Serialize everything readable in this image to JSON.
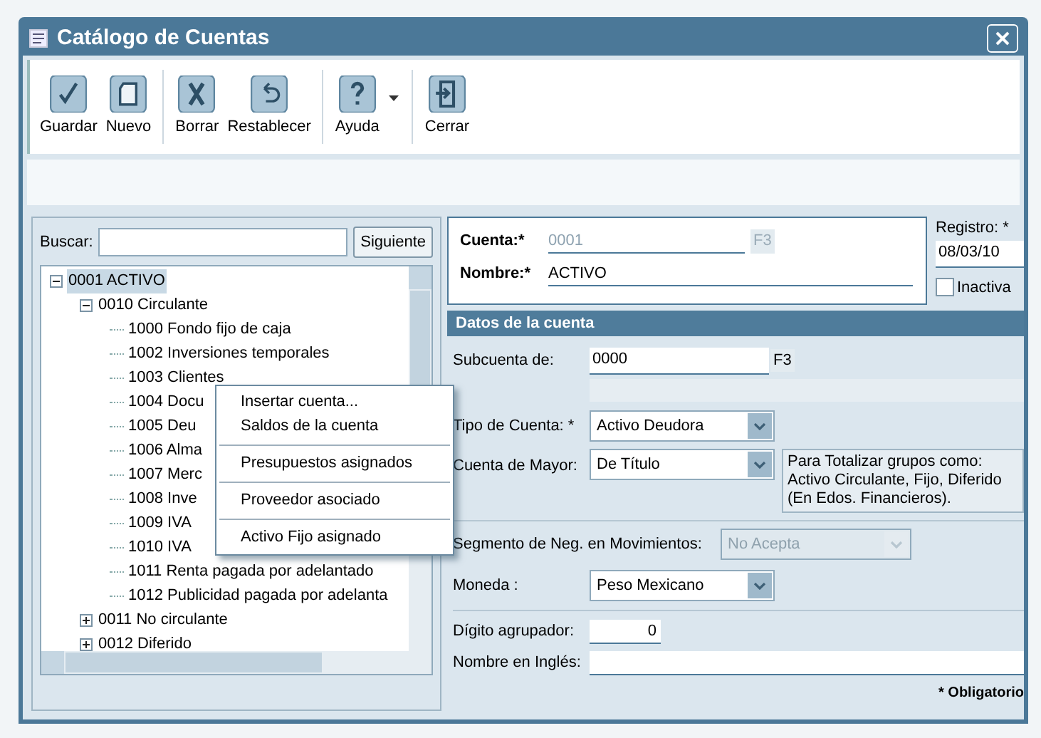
{
  "window": {
    "title": "Catálogo de Cuentas"
  },
  "toolbar_groups": [
    [
      {
        "label": "Guardar",
        "kind": "check",
        "dropdown": false
      },
      {
        "label": "Nuevo",
        "kind": "page",
        "dropdown": false
      }
    ],
    [
      {
        "label": "Borrar",
        "kind": "x",
        "dropdown": false
      },
      {
        "label": "Restablecer",
        "kind": "undo",
        "dropdown": false
      }
    ],
    [
      {
        "label": "Ayuda",
        "kind": "help",
        "dropdown": true
      }
    ],
    [
      {
        "label": "Cerrar",
        "kind": "exit",
        "dropdown": false
      }
    ]
  ],
  "search": {
    "label": "Buscar:",
    "button": "Siguiente"
  },
  "tree": [
    {
      "label": "0001 ACTIVO",
      "selected": true,
      "expanded": true,
      "children": [
        {
          "label": "0010 Circulante",
          "selected": false,
          "expanded": true,
          "children": [
            {
              "label": "1000 Fondo fijo de caja",
              "selected": false
            },
            {
              "label": "1002 Inversiones temporales",
              "selected": false
            },
            {
              "label": "1003 Clientes",
              "selected": false
            },
            {
              "label": "1004 Docu",
              "selected": false
            },
            {
              "label": "1005 Deu",
              "selected": false
            },
            {
              "label": "1006 Alma",
              "selected": false
            },
            {
              "label": "1007 Merc",
              "selected": false
            },
            {
              "label": "1008 Inve",
              "selected": false
            },
            {
              "label": "1009 IVA",
              "selected": false
            },
            {
              "label": "1010 IVA",
              "selected": false
            },
            {
              "label": "1011 Renta pagada por adelantado",
              "selected": false
            },
            {
              "label": "1012 Publicidad pagada por adelanta",
              "selected": false
            }
          ]
        },
        {
          "label": "0011 No circulante",
          "selected": false,
          "expanded": false
        },
        {
          "label": "0012 Diferido",
          "selected": false,
          "expanded": false
        }
      ]
    }
  ],
  "context_menu": [
    [
      "Insertar cuenta...",
      "Saldos de la cuenta"
    ],
    [
      "Presupuestos asignados"
    ],
    [
      "Proveedor asociado"
    ],
    [
      "Activo Fijo asignado"
    ]
  ],
  "cuenta": {
    "label": "Cuenta:*",
    "value": "0001",
    "disabled": true,
    "key": "F3"
  },
  "nombre": {
    "label": "Nombre:*",
    "value": "ACTIVO"
  },
  "registro": {
    "label": "Registro: *",
    "value": "08/03/10"
  },
  "inactiva": {
    "label": "Inactiva",
    "checked": false
  },
  "section_title": "Datos de la cuenta",
  "subcuenta": {
    "label": "Subcuenta de:",
    "value": "0000",
    "key": "F3"
  },
  "tipo": {
    "label": "Tipo de Cuenta: *",
    "value": "Activo Deudora",
    "disabled": false
  },
  "mayor": {
    "label": "Cuenta de Mayor:",
    "value": "De Título",
    "disabled": false,
    "note": "Para Totalizar grupos como: Activo Circulante, Fijo, Diferido (En Edos. Financieros)."
  },
  "segmento": {
    "label": "Segmento de Neg. en Movimientos:",
    "value": "No Acepta",
    "disabled": true
  },
  "moneda": {
    "label": "Moneda :",
    "value": "Peso Mexicano",
    "disabled": false
  },
  "digito": {
    "label": "Dígito agrupador:",
    "value": "0"
  },
  "ingles": {
    "label": "Nombre en Inglés:"
  },
  "required_note": "* Obligatorio"
}
